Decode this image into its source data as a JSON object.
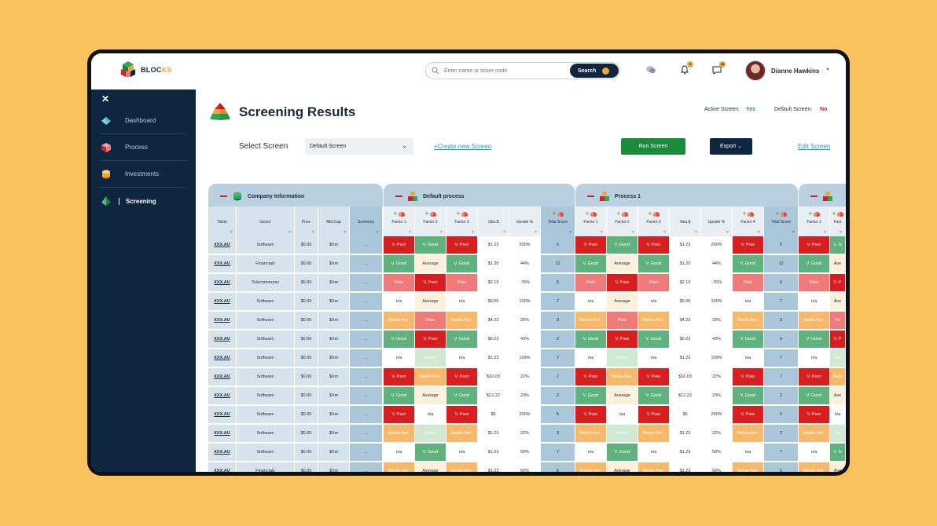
{
  "brand": {
    "name_part1": "BLOC",
    "name_part2": "KS",
    "accent": "#F6A33A",
    "navy": "#0f2640",
    "background": "#F9C25D"
  },
  "search": {
    "placeholder": "Enter name or ticker code",
    "button_label": "Search"
  },
  "header": {
    "notifications_count": "5",
    "messages_count": "15",
    "user_name": "Dianne Hawkins"
  },
  "sidebar": {
    "items": [
      {
        "label": "Dashboard",
        "icon": "diamond-icon"
      },
      {
        "label": "Process",
        "icon": "cube-icon"
      },
      {
        "label": "Investments",
        "icon": "coins-icon"
      },
      {
        "label": "Screening",
        "icon": "pyramid-icon"
      }
    ]
  },
  "page": {
    "title": "Screening Results",
    "active_screen_label": "Active Screen:",
    "active_screen_value": "Yes",
    "default_screen_label": "Default Screen:",
    "default_screen_value": "No",
    "select_label": "Select Screen",
    "select_value": "Default Screen",
    "create_link": "+Create new Screen",
    "run_button": "Run Screen",
    "export_button": "Export",
    "edit_link": "Edit Screen"
  },
  "table": {
    "groups": {
      "company": "Company Information",
      "default_process": "Default process",
      "process1": "Process 1"
    },
    "company_columns": [
      "Ticker",
      "Sector",
      "Price",
      "Mkt.Cap",
      "Summary"
    ],
    "default_columns": [
      "Factor 1",
      "Factor 2",
      "Factor 3",
      "Valu.$",
      "Upside %",
      "Total Score"
    ],
    "process1_columns": [
      "Factor 1",
      "Factor 2",
      "Factor 3",
      "Valu.$",
      "Upside %",
      "Factor 4",
      "Total Score"
    ],
    "next_columns": [
      "Factor 1",
      "Fact"
    ],
    "rows": [
      {
        "ticker": "XXX.AU",
        "sector": "Software",
        "price": "$0.00",
        "mktcap": "$Xm",
        "summary": "...",
        "f1": "V. Poor",
        "f2": "V. Good",
        "f3": "V. Poor",
        "valu": "$1.23",
        "upside": "200%",
        "total": "5",
        "f4": "V. Poor",
        "n2": "V. G"
      },
      {
        "ticker": "XXX.AU",
        "sector": "Financials",
        "price": "$0.00",
        "mktcap": "$Xm",
        "summary": "...",
        "f1": "V. Good",
        "f2": "Average",
        "f3": "V. Good",
        "valu": "$1.20",
        "upside": "44%",
        "total": "12",
        "f4": "V. Good",
        "n2": "Ave"
      },
      {
        "ticker": "XXX.AU",
        "sector": "Telecommunic",
        "price": "$0.00",
        "mktcap": "$Xm",
        "summary": "...",
        "f1": "Poor",
        "f2": "V. Poor",
        "f3": "Poor",
        "valu": "$2.19",
        "upside": "-76%",
        "total": "6",
        "f4": "Poor",
        "n2": "V. P"
      },
      {
        "ticker": "XXX.AU",
        "sector": "Software",
        "price": "$0.00",
        "mktcap": "$Xm",
        "summary": "...",
        "f1": "n/a",
        "f2": "Average",
        "f3": "n/a",
        "valu": "$0.05",
        "upside": "100%",
        "total": "7",
        "f4": "n/a",
        "n2": "Ave"
      },
      {
        "ticker": "XXX.AU",
        "sector": "Software",
        "price": "$0.00",
        "mktcap": "$Xm",
        "summary": "...",
        "f1": "Below Ave.",
        "f2": "Poor",
        "f3": "Below Ave.",
        "valu": "$4.23",
        "upside": "20%",
        "total": "3",
        "f4": "Below Ave.",
        "n2": "Po"
      },
      {
        "ticker": "XXX.AU",
        "sector": "Software",
        "price": "$0.00",
        "mktcap": "$Xm",
        "summary": "...",
        "f1": "V. Good",
        "f2": "V. Poor",
        "f3": "V. Good",
        "valu": "$0.23",
        "upside": "43%",
        "total": "2",
        "f4": "V. Good",
        "n2": "V. P"
      },
      {
        "ticker": "XXX.AU",
        "sector": "Software",
        "price": "$0.00",
        "mktcap": "$Xm",
        "summary": "...",
        "f1": "n/a",
        "f2": "Good",
        "f3": "n/a",
        "valu": "$1.23",
        "upside": "109%",
        "total": "7",
        "f4": "n/a",
        "n2": "Go"
      },
      {
        "ticker": "XXX.AU",
        "sector": "Software",
        "price": "$0.00",
        "mktcap": "$Xm",
        "summary": "...",
        "f1": "V. Poor",
        "f2": "Below Ave.",
        "f3": "V. Poor",
        "valu": "$10.03",
        "upside": "22%",
        "total": "7",
        "f4": "V. Poor",
        "n2": "Belo"
      },
      {
        "ticker": "XXX.AU",
        "sector": "Software",
        "price": "$0.00",
        "mktcap": "$Xm",
        "summary": "...",
        "f1": "V. Good",
        "f2": "Average",
        "f3": "V. Good",
        "valu": "$12.22",
        "upside": "23%",
        "total": "2",
        "f4": "V. Good",
        "n2": "Ave"
      },
      {
        "ticker": "XXX.AU",
        "sector": "Software",
        "price": "$0.00",
        "mktcap": "$Xm",
        "summary": "...",
        "f1": "V. Poor",
        "f2": "n/a",
        "f3": "V. Poor",
        "valu": "$5",
        "upside": "200%",
        "total": "5",
        "f4": "V. Poor",
        "n2": "n/a"
      },
      {
        "ticker": "XXX.AU",
        "sector": "Software",
        "price": "$0.00",
        "mktcap": "$Xm",
        "summary": "...",
        "f1": "Below Ave.",
        "f2": "Good",
        "f3": "Below Ave.",
        "valu": "$1.23",
        "upside": "22%",
        "total": "3",
        "f4": "Below Ave.",
        "n2": "Go"
      },
      {
        "ticker": "XXX.AU",
        "sector": "Software",
        "price": "$0.00",
        "mktcap": "$Xm",
        "summary": "...",
        "f1": "n/a",
        "f2": "V. Good",
        "f3": "n/a",
        "valu": "$1.23",
        "upside": "50%",
        "total": "7",
        "f4": "n/a",
        "n2": "V. G"
      },
      {
        "ticker": "XXX.AU",
        "sector": "Financials",
        "price": "$0.00",
        "mktcap": "$Xm",
        "summary": "...",
        "f1": "Below Ave.",
        "f2": "Average",
        "f3": "Below Ave.",
        "valu": "$1.23",
        "upside": "60%",
        "total": "5",
        "f4": "Below Ave.",
        "n2": "Ave"
      }
    ]
  }
}
